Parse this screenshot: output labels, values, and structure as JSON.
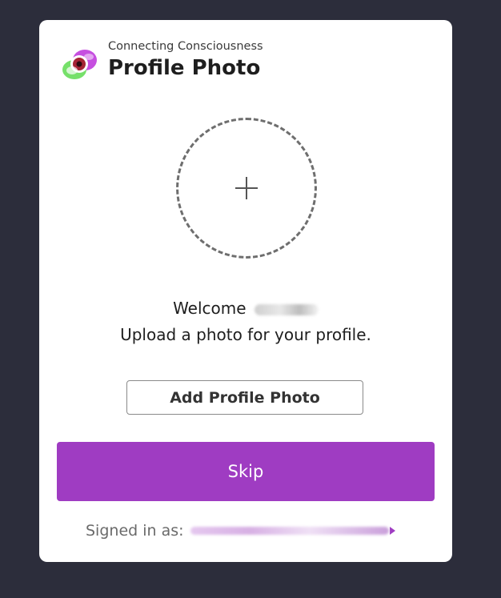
{
  "header": {
    "org_name": "Connecting Consciousness",
    "title": "Profile Photo",
    "logo": "connecting-consciousness-logo"
  },
  "upload": {
    "icon": "plus-icon"
  },
  "welcome": {
    "prefix": "Welcome",
    "instruction": "Upload a photo for your profile."
  },
  "actions": {
    "add_photo_label": "Add Profile Photo",
    "skip_label": "Skip"
  },
  "footer": {
    "signed_in_label": "Signed in as:"
  },
  "colors": {
    "background": "#2c2d3b",
    "accent": "#9f3cc2",
    "card": "#ffffff"
  }
}
